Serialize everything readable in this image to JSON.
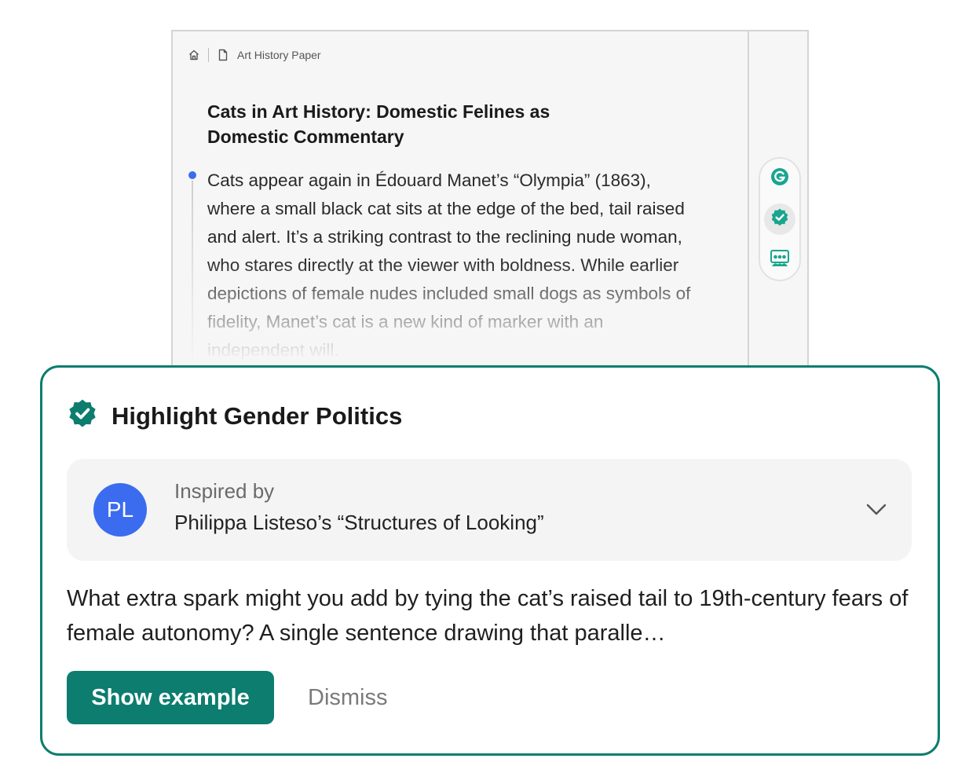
{
  "document": {
    "breadcrumb": {
      "home_icon": "home-icon",
      "doc_icon": "document-icon",
      "label": "Art History Paper"
    },
    "title": "Cats in Art History: Domestic Felines as Domestic Commentary",
    "body": "Cats appear again in Édouard Manet’s “Olympia” (1863), where a small black cat sits at the edge of the bed, tail raised and alert. It’s a striking contrast to the reclining nude woman, who stares directly at the viewer with boldness. While earlier depictions of female nudes included small dogs as symbols of fidelity, Manet’s cat is a new kind of marker with an independent will.",
    "tools": [
      {
        "icon": "grammarly-icon",
        "active": false
      },
      {
        "icon": "verified-badge-icon",
        "active": true
      },
      {
        "icon": "people-icon",
        "active": false
      }
    ]
  },
  "suggestion": {
    "icon": "verified-badge-icon",
    "title": "Highlight Gender Politics",
    "inspired_label": "Inspired by",
    "inspired_source": "Philippa Listeso’s “Structures of Looking”",
    "avatar_initials": "PL",
    "prompt": "What extra spark might you add by tying the cat’s raised tail to 19th-century fears of female autonomy? A single sentence drawing that paralle…",
    "primary_action": "Show example",
    "secondary_action": "Dismiss"
  },
  "colors": {
    "accent": "#0c7d6e",
    "avatar": "#3b6cf0",
    "cursor": "#3b6cf0"
  }
}
